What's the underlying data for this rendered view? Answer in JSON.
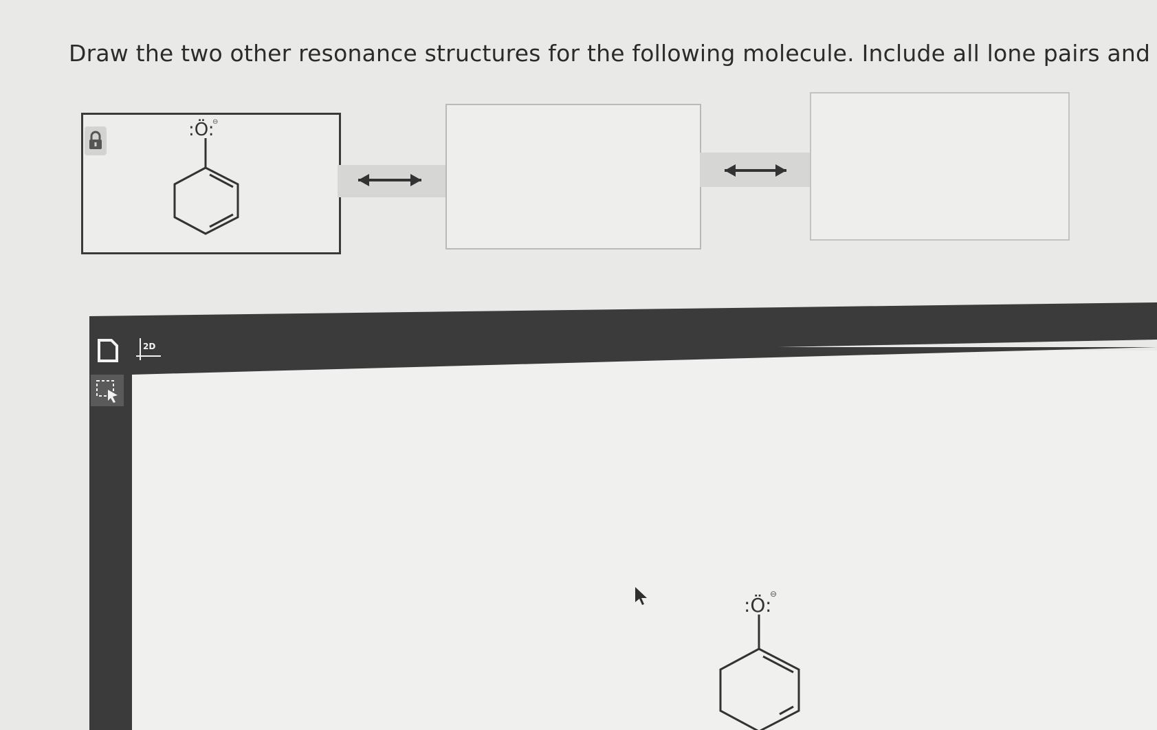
{
  "question": "Draw the two other resonance structures for the following molecule. Include all lone pairs and formal charg",
  "molecule_label": ":Ö:",
  "charge_symbol": "⊖",
  "toolbar": {
    "document_icon": "document-icon",
    "twod_label": "2D",
    "select_icon": "marquee-select-icon"
  },
  "colors": {
    "background": "#e9e9e7",
    "toolbar": "#3b3b3b",
    "connector": "#d6d6d4"
  }
}
